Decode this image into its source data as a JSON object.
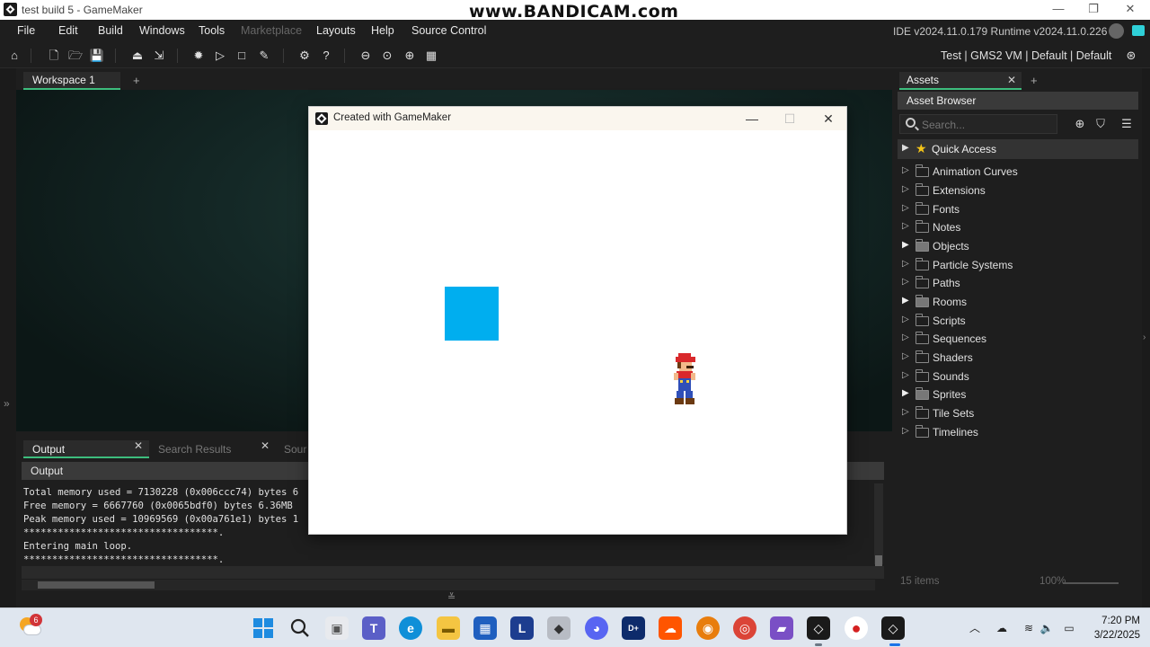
{
  "titlebar": {
    "title": "test build 5 - GameMaker",
    "watermark": "www.BANDICAM.com",
    "minimize": "—",
    "restore": "❐",
    "close": "✕"
  },
  "menu": {
    "items": [
      "File",
      "Edit",
      "Build",
      "Windows",
      "Tools",
      "Marketplace",
      "Layouts",
      "Help",
      "Source Control"
    ],
    "version": "IDE v2024.11.0.179  Runtime v2024.11.0.226"
  },
  "toolbar": {
    "targets": "Test  |  GMS2 VM  |  Default  |  Default"
  },
  "workspace": {
    "tab_label": "Workspace 1",
    "add_tab": "+"
  },
  "output": {
    "tabs": [
      "Output",
      "Search Results",
      "Sour"
    ],
    "header": "Output",
    "log": [
      "Total memory used = 7130228 (0x006ccc74) bytes 6",
      "Free memory = 6667760 (0x0065bdf0) bytes 6.36MB",
      "Peak memory used = 10969569 (0x00a761e1) bytes 1",
      "**********************************.",
      "Entering main loop.",
      "**********************************."
    ]
  },
  "game_window": {
    "title": "Created with GameMaker",
    "minimize": "—",
    "maximize": "☐",
    "close": "✕",
    "block_color": "#00aeef"
  },
  "assets": {
    "tab_label": "Assets",
    "add_tab": "+",
    "browser_title": "Asset Browser",
    "search_placeholder": "Search...",
    "quick_access": "Quick Access",
    "folders": [
      {
        "label": "Animation Curves",
        "filled": false
      },
      {
        "label": "Extensions",
        "filled": false
      },
      {
        "label": "Fonts",
        "filled": false
      },
      {
        "label": "Notes",
        "filled": false
      },
      {
        "label": "Objects",
        "filled": true
      },
      {
        "label": "Particle Systems",
        "filled": false
      },
      {
        "label": "Paths",
        "filled": false
      },
      {
        "label": "Rooms",
        "filled": true
      },
      {
        "label": "Scripts",
        "filled": false
      },
      {
        "label": "Sequences",
        "filled": false
      },
      {
        "label": "Shaders",
        "filled": false
      },
      {
        "label": "Sounds",
        "filled": false
      },
      {
        "label": "Sprites",
        "filled": true
      },
      {
        "label": "Tile Sets",
        "filled": false
      },
      {
        "label": "Timelines",
        "filled": false
      }
    ],
    "items_count": "15 items",
    "zoom": "100%"
  },
  "taskbar": {
    "weather_badge": "6",
    "time": "7:20 PM",
    "date": "3/22/2025"
  }
}
